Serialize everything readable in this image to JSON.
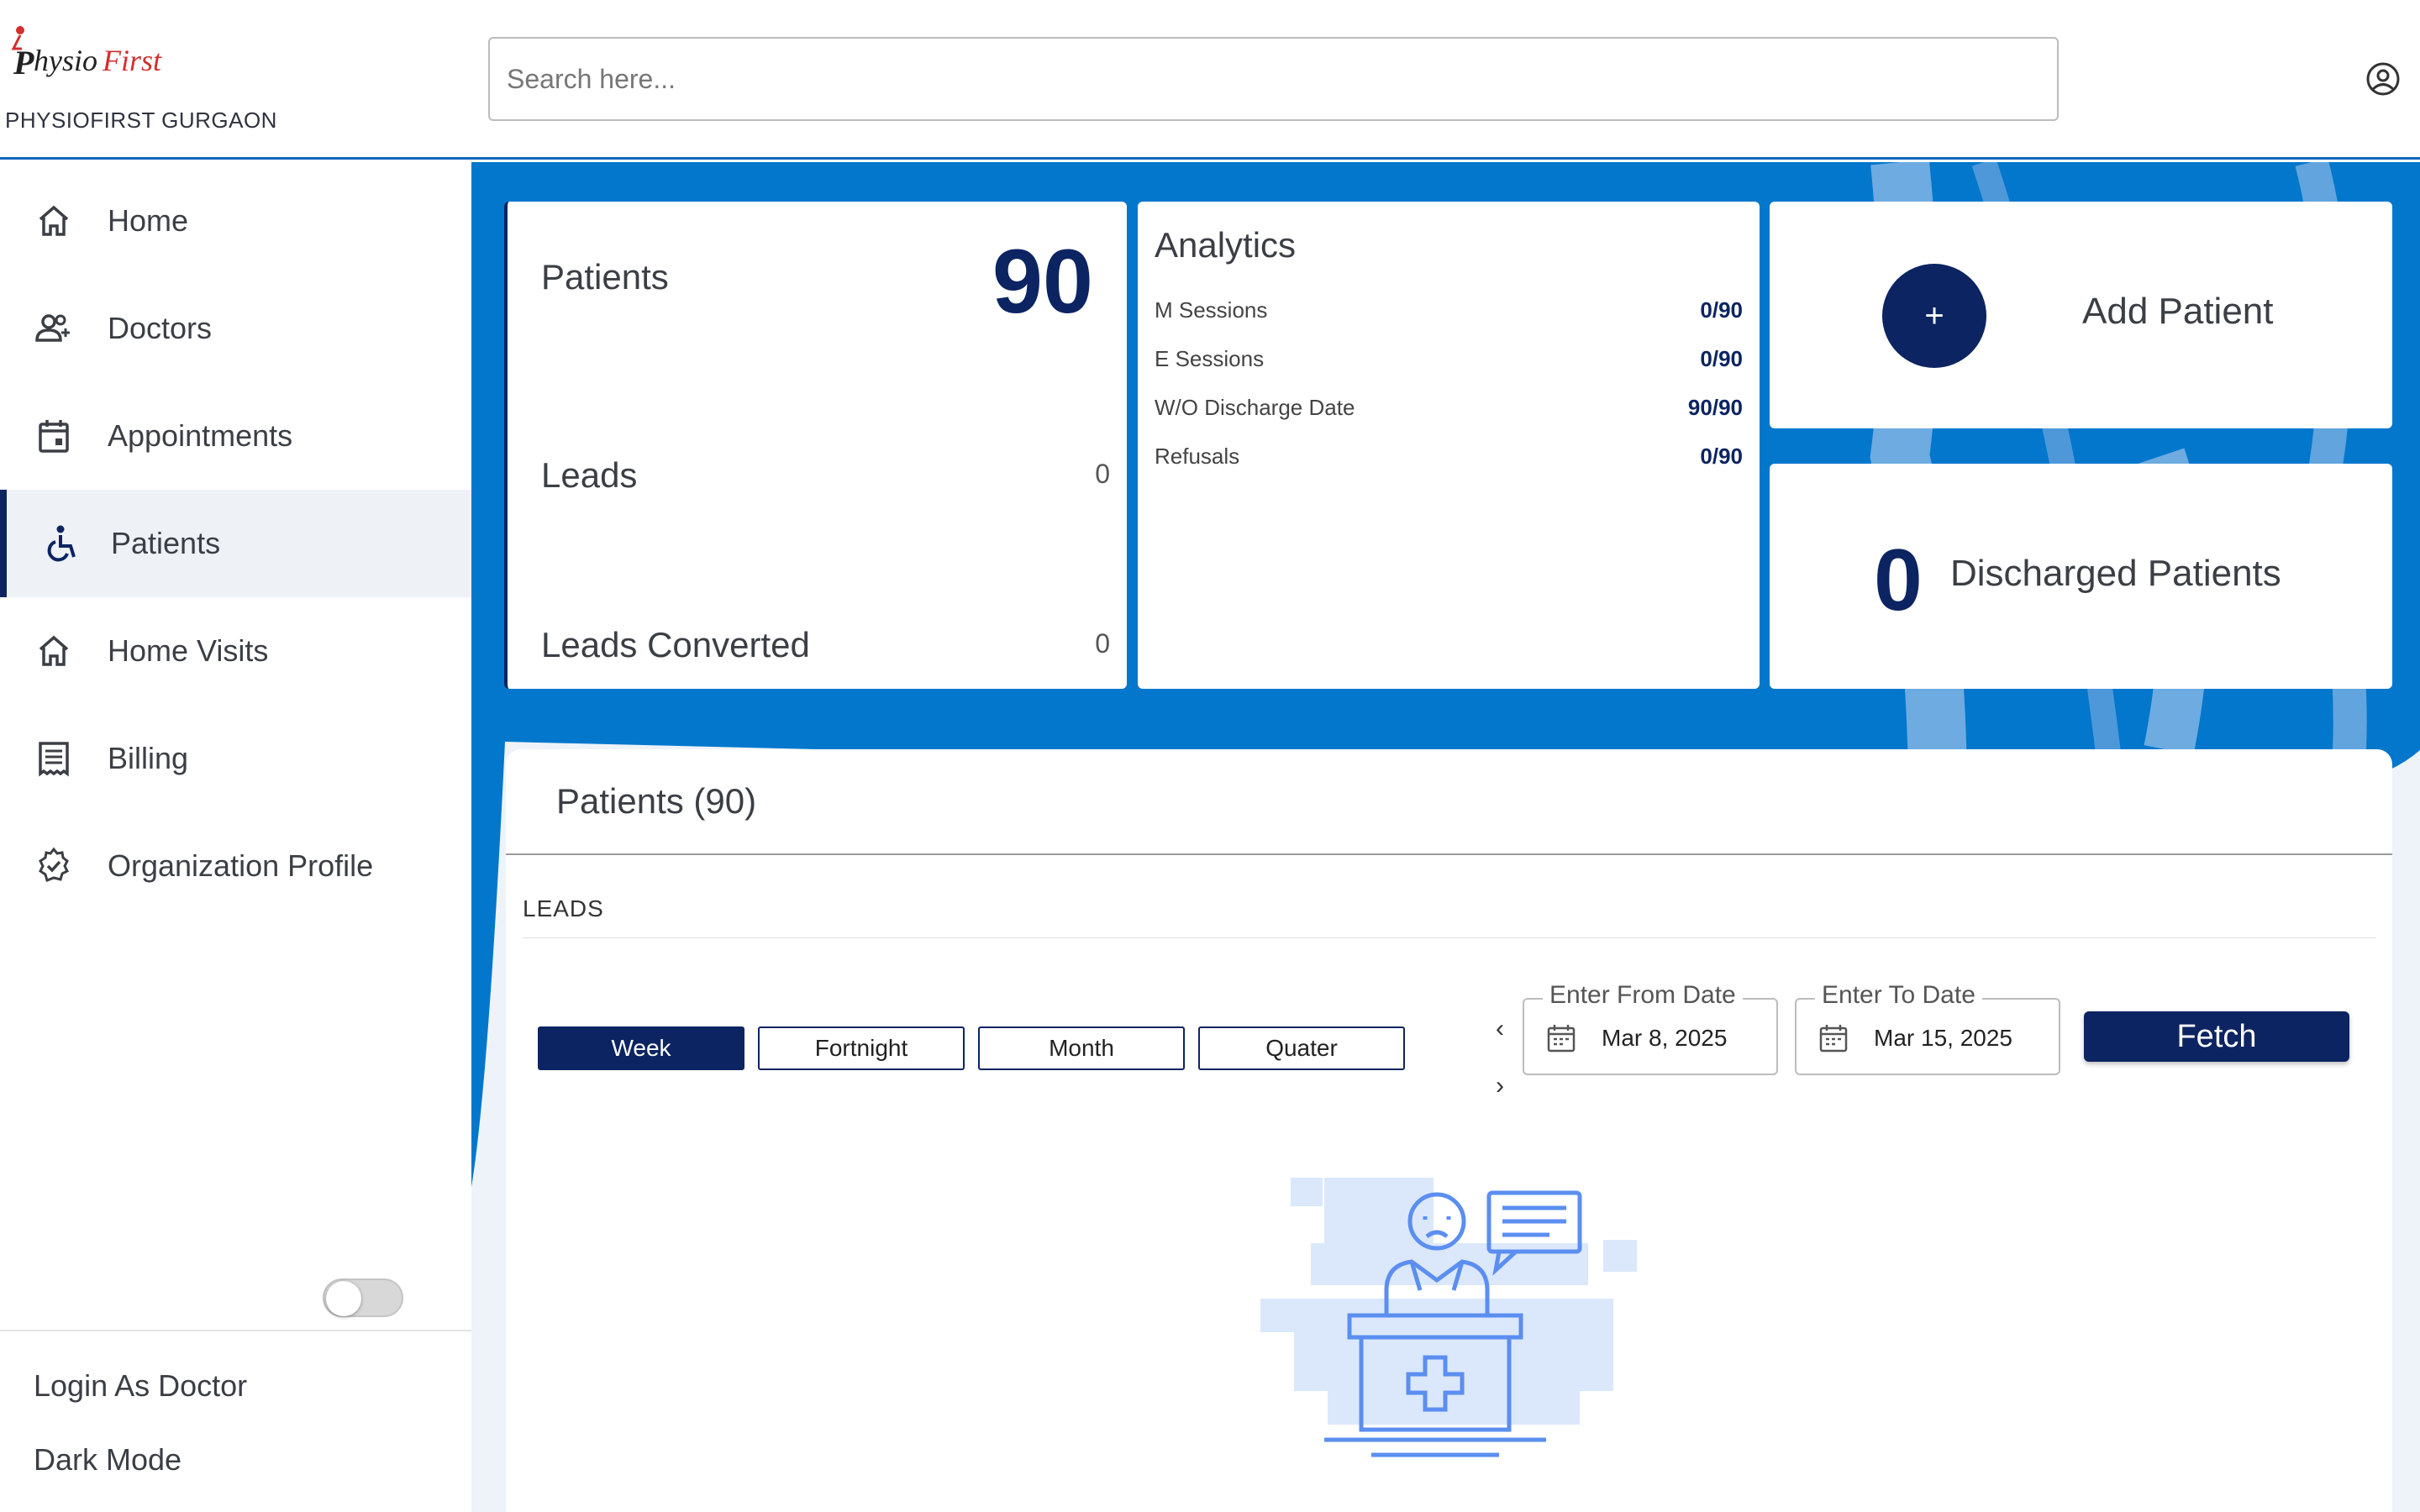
{
  "header": {
    "logo_text": "PhysioFirst",
    "org_name": "PHYSIOFIRST GURGAON",
    "search_placeholder": "Search here...",
    "account_icon": "account-circle-icon"
  },
  "sidebar": {
    "items": [
      {
        "label": "Home",
        "icon": "home-icon",
        "active": false
      },
      {
        "label": "Doctors",
        "icon": "doctors-icon",
        "active": false
      },
      {
        "label": "Appointments",
        "icon": "calendar-icon",
        "active": false
      },
      {
        "label": "Patients",
        "icon": "accessible-icon",
        "active": true
      },
      {
        "label": "Home Visits",
        "icon": "home-icon",
        "active": false
      },
      {
        "label": "Billing",
        "icon": "receipt-icon",
        "active": false
      },
      {
        "label": "Organization Profile",
        "icon": "verified-badge-icon",
        "active": false
      }
    ],
    "login_as_doctor": "Login As Doctor",
    "dark_mode": "Dark Mode",
    "dark_mode_on": false
  },
  "stats": {
    "patients_label": "Patients",
    "patients_value": "90",
    "leads_label": "Leads",
    "leads_value": "0",
    "leads_converted_label": "Leads Converted",
    "leads_converted_value": "0"
  },
  "analytics": {
    "title": "Analytics",
    "rows": [
      {
        "label": "M Sessions",
        "value": "0/90"
      },
      {
        "label": "E Sessions",
        "value": "0/90"
      },
      {
        "label": "W/O Discharge Date",
        "value": "90/90"
      },
      {
        "label": "Refusals",
        "value": "0/90"
      }
    ]
  },
  "add_patient": {
    "button_symbol": "+",
    "label": "Add Patient"
  },
  "discharged": {
    "value": "0",
    "label": "Discharged Patients"
  },
  "panel": {
    "title": "Patients (90)",
    "leads_label": "LEADS",
    "periods": [
      "Week",
      "Fortnight",
      "Month",
      "Quater"
    ],
    "active_period": "Week",
    "from_date_label": "Enter From Date",
    "from_date_value": "Mar 8, 2025",
    "to_date_label": "Enter To Date",
    "to_date_value": "Mar 15, 2025",
    "prev_symbol": "‹",
    "next_symbol": "›",
    "fetch_label": "Fetch"
  },
  "colors": {
    "primary_navy": "#0c2461",
    "accent_blue": "#0277cc",
    "illustration_blue": "#5b8ef0"
  }
}
